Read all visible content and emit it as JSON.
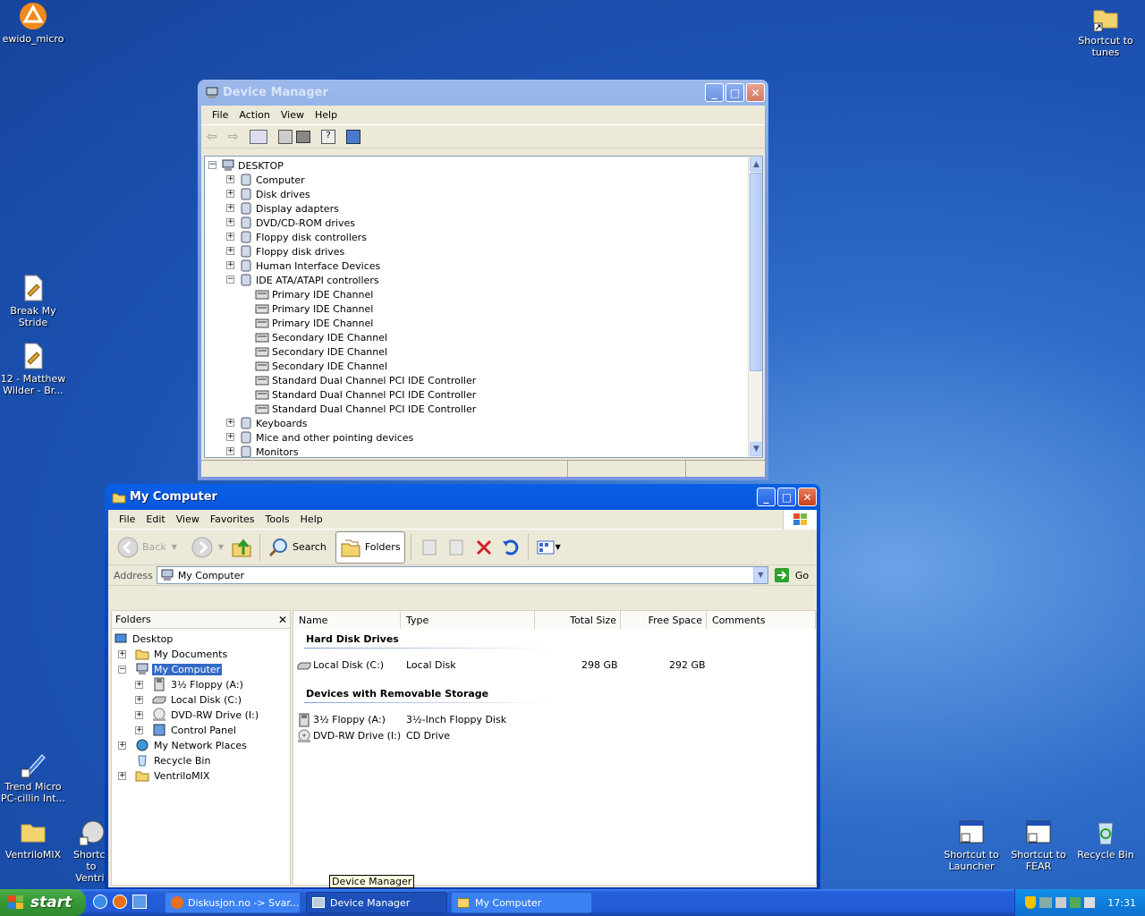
{
  "desktop": {
    "icons": [
      {
        "label": "ewido_micro"
      },
      {
        "label": "Shortcut to tunes"
      },
      {
        "label": "Break My Stride"
      },
      {
        "label": "12 - Matthew Wilder - Br..."
      },
      {
        "label": "Trend Micro PC-cillin Int..."
      },
      {
        "label": "VentriloMIX"
      },
      {
        "label": "Shortcut to Ventril"
      },
      {
        "label": "Shortcut to Launcher"
      },
      {
        "label": "Shortcut to FEAR"
      },
      {
        "label": "Recycle Bin"
      }
    ]
  },
  "device_manager": {
    "title": "Device Manager",
    "menu": [
      "File",
      "Action",
      "View",
      "Help"
    ],
    "root": "DESKTOP",
    "categories": [
      {
        "label": "Computer",
        "expanded": false
      },
      {
        "label": "Disk drives",
        "expanded": false
      },
      {
        "label": "Display adapters",
        "expanded": false
      },
      {
        "label": "DVD/CD-ROM drives",
        "expanded": false
      },
      {
        "label": "Floppy disk controllers",
        "expanded": false
      },
      {
        "label": "Floppy disk drives",
        "expanded": false
      },
      {
        "label": "Human Interface Devices",
        "expanded": false
      },
      {
        "label": "IDE ATA/ATAPI controllers",
        "expanded": true
      }
    ],
    "ide_children": [
      "Primary IDE Channel",
      "Primary IDE Channel",
      "Primary IDE Channel",
      "Secondary IDE Channel",
      "Secondary IDE Channel",
      "Secondary IDE Channel",
      "Standard Dual Channel PCI IDE Controller",
      "Standard Dual Channel PCI IDE Controller",
      "Standard Dual Channel PCI IDE Controller"
    ],
    "categories_after": [
      {
        "label": "Keyboards"
      },
      {
        "label": "Mice and other pointing devices"
      },
      {
        "label": "Monitors"
      }
    ]
  },
  "my_computer": {
    "title": "My Computer",
    "menu": [
      "File",
      "Edit",
      "View",
      "Favorites",
      "Tools",
      "Help"
    ],
    "toolbar": {
      "back": "Back",
      "search": "Search",
      "folders": "Folders"
    },
    "address": {
      "label": "Address",
      "value": "My Computer",
      "go": "Go"
    },
    "folders_pane": {
      "title": "Folders",
      "items": [
        {
          "label": "Desktop"
        },
        {
          "label": "My Documents"
        },
        {
          "label": "My Computer"
        },
        {
          "label": "3½ Floppy (A:)"
        },
        {
          "label": "Local Disk (C:)"
        },
        {
          "label": "DVD-RW Drive (I:)"
        },
        {
          "label": "Control Panel"
        },
        {
          "label": "My Network Places"
        },
        {
          "label": "Recycle Bin"
        },
        {
          "label": "VentriloMIX"
        }
      ]
    },
    "columns": [
      "Name",
      "Type",
      "Total Size",
      "Free Space",
      "Comments"
    ],
    "groups": [
      {
        "title": "Hard Disk Drives",
        "rows": [
          {
            "name": "Local Disk (C:)",
            "type": "Local Disk",
            "total": "298 GB",
            "free": "292 GB",
            "comments": ""
          }
        ]
      },
      {
        "title": "Devices with Removable Storage",
        "rows": [
          {
            "name": "3½ Floppy (A:)",
            "type": "3½-Inch Floppy Disk",
            "total": "",
            "free": "",
            "comments": ""
          },
          {
            "name": "DVD-RW Drive (I:)",
            "type": "CD Drive",
            "total": "",
            "free": "",
            "comments": ""
          }
        ]
      }
    ]
  },
  "tooltip": "Device Manager",
  "taskbar": {
    "start": "start",
    "tasks": [
      {
        "label": "Diskusjon.no -> Svar..."
      },
      {
        "label": "Device Manager"
      },
      {
        "label": "My Computer"
      }
    ],
    "clock": "17:31"
  },
  "colors": {
    "selection": "#316ac5",
    "title_active": "#0a5fe6",
    "taskbar": "#245edb",
    "start_green": "#379b37"
  }
}
